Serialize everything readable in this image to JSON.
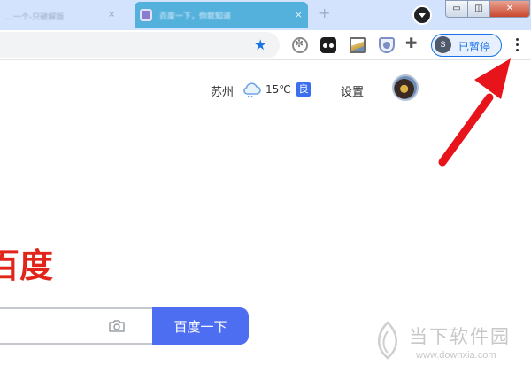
{
  "browser": {
    "tabs": [
      {
        "title": "…一个-只破解版",
        "active": false
      },
      {
        "title": "百度一下，你就知道",
        "active": true
      }
    ],
    "tab_close_glyph": "×",
    "new_tab_glyph": "+",
    "window_controls": {
      "minimize": "▭",
      "maximize": "◫",
      "close": "✕"
    },
    "toolbar": {
      "bookmark_icon": "star-icon",
      "extensions": [
        "flower-extension-icon",
        "tampermonkey-icon",
        "image-extension-icon",
        "shield-extension-icon",
        "puzzle-icon"
      ],
      "profile": {
        "initial": "S",
        "label": "已暂停"
      },
      "menu_icon": "three-dots-vertical-icon"
    },
    "accent_color": "#1a73e8"
  },
  "page": {
    "weather": {
      "city": "苏州",
      "icon": "cloud-icon",
      "temperature": "15℃",
      "air_quality": "良"
    },
    "settings_label": "设置",
    "avatar": "user-avatar",
    "logo_text": "百度",
    "search": {
      "placeholder": "",
      "button_label": "百度一下"
    },
    "brand_color": "#e1251b",
    "button_color": "#4e6ef2"
  },
  "annotation": {
    "type": "red-arrow",
    "color": "#e8141b",
    "points_to": "browser-menu-button"
  },
  "watermark": {
    "name": "当下软件园",
    "url": "www.downxia.com"
  }
}
